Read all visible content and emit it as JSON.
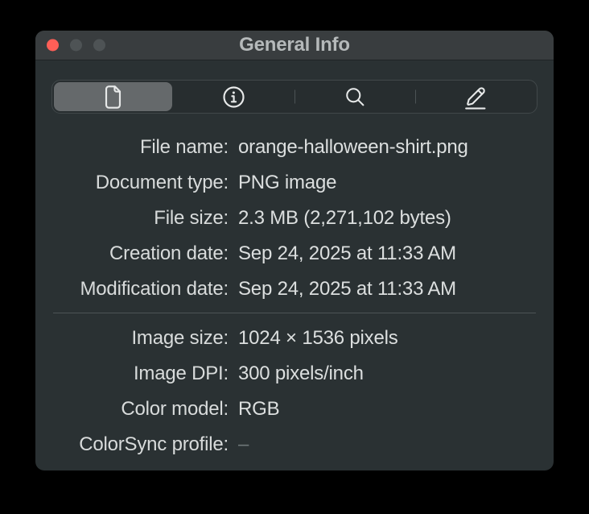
{
  "window": {
    "title": "General Info",
    "traffic_lights": {
      "close_color": "#fe5f57",
      "disabled_color": "#4e5355"
    }
  },
  "toolbar": {
    "segments": [
      {
        "label": "general-document",
        "icon": "document-icon",
        "selected": true
      },
      {
        "label": "more-info",
        "icon": "info-icon",
        "selected": false
      },
      {
        "label": "keywords-search",
        "icon": "search-icon",
        "selected": false
      },
      {
        "label": "annotations",
        "icon": "pencil-icon",
        "selected": false
      }
    ]
  },
  "info": {
    "rows_top": [
      {
        "label": "File name:",
        "value": "orange-halloween-shirt.png"
      },
      {
        "label": "Document type:",
        "value": "PNG image"
      },
      {
        "label": "File size:",
        "value": "2.3 MB (2,271,102 bytes)"
      },
      {
        "label": "Creation date:",
        "value": "Sep 24, 2025 at 11:33 AM"
      },
      {
        "label": "Modification date:",
        "value": "Sep 24, 2025 at 11:33 AM"
      }
    ],
    "rows_bottom": [
      {
        "label": "Image size:",
        "value": "1024 × 1536 pixels"
      },
      {
        "label": "Image DPI:",
        "value": "300 pixels/inch"
      },
      {
        "label": "Color model:",
        "value": "RGB"
      },
      {
        "label": "ColorSync profile:",
        "value": "–"
      }
    ]
  },
  "colors": {
    "window_background": "#2a3133",
    "titlebar_background": "#393d3f",
    "segmented_track": "#272d2f",
    "segment_selected": "#65696b",
    "text": "#dcdfdf",
    "title_text": "#b5b9ba",
    "divider": "#4c5456"
  }
}
